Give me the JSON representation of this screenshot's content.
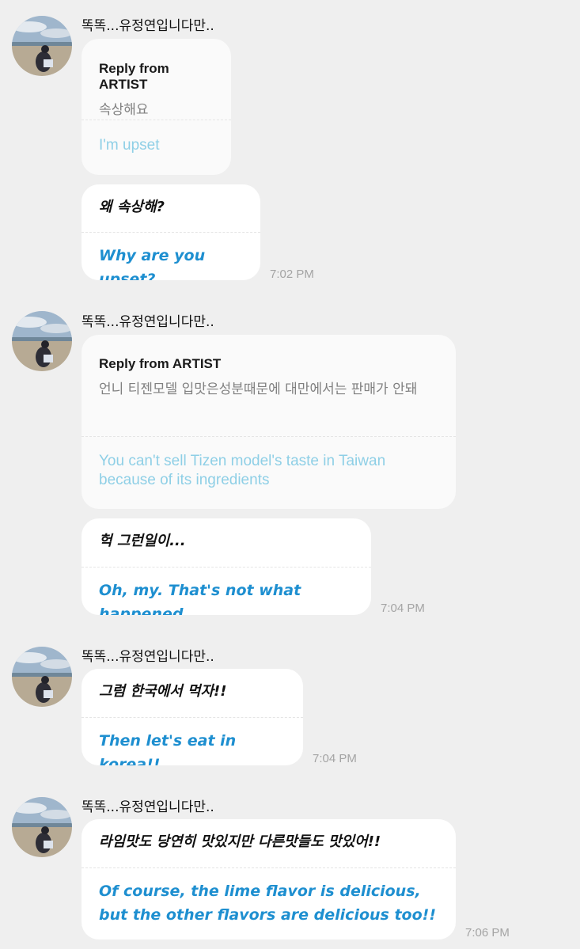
{
  "colors": {
    "background": "#efefef",
    "bubble": "#ffffff",
    "reply_bubble": "#fafafa",
    "translation_accent": "#1e8fd0",
    "reply_translation": "#8ecfe6",
    "timestamp": "#a4a4a4"
  },
  "groups": [
    {
      "sender": "똑똑...유정연입니다만..",
      "avatar_icon": "beach-photo-avatar",
      "reply": {
        "label": "Reply from ARTIST",
        "original": "속상해요",
        "translation": "I'm upset"
      },
      "message": {
        "text": "왜 속상해?",
        "translation": "Why are you upset?",
        "time": "7:02 PM"
      }
    },
    {
      "sender": "똑똑...유정연입니다만..",
      "avatar_icon": "beach-photo-avatar",
      "reply": {
        "label": "Reply from ARTIST",
        "original": " 언니 티젠모델 입맛은성분때문에 대만에서는 판매가 안돼",
        "translation": "You can't sell Tizen model's taste in Taiwan because of its ingredients"
      },
      "message": {
        "text": "헉 그런일이...",
        "translation": "Oh, my. That's not what happened...",
        "time": "7:04 PM"
      }
    },
    {
      "sender": "똑똑...유정연입니다만..",
      "avatar_icon": "beach-photo-avatar",
      "message": {
        "text": "그럼 한국에서 먹자!!",
        "translation": "Then let's eat in korea!!",
        "time": "7:04 PM"
      }
    },
    {
      "sender": "똑똑...유정연입니다만..",
      "avatar_icon": "beach-photo-avatar",
      "message": {
        "text": "라임맛도 당연히 맛있지만 다른맛들도 맛있어!!",
        "translation": "Of course, the lime flavor is delicious, but the other flavors are delicious too!!",
        "time": "7:06 PM"
      }
    }
  ]
}
